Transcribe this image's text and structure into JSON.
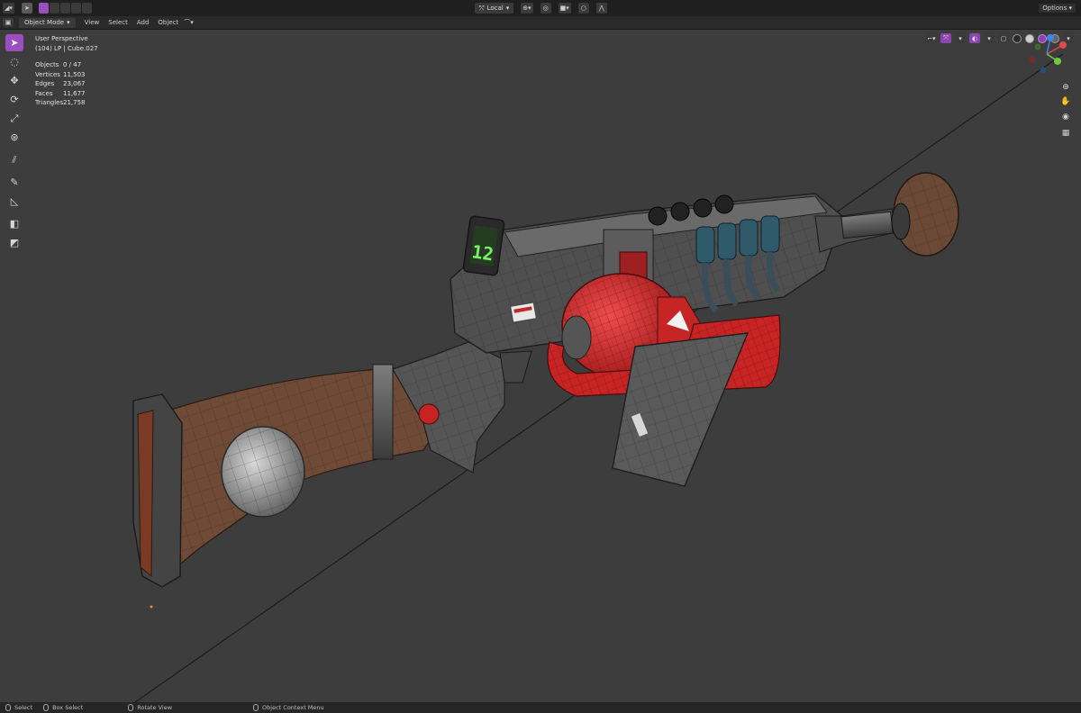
{
  "header": {
    "editor_icon": "3d-viewport-icon",
    "mode": "Object Mode",
    "menus": [
      "View",
      "Select",
      "Add",
      "Object"
    ],
    "transform_orientation": "Local",
    "options": "Options"
  },
  "overlay": {
    "view_name": "User Perspective",
    "object_name": "(104) LP | Cube.027",
    "stats": [
      {
        "label": "Objects",
        "value": "0 / 47"
      },
      {
        "label": "Vertices",
        "value": "11,503"
      },
      {
        "label": "Edges",
        "value": "23,067"
      },
      {
        "label": "Faces",
        "value": "11,677"
      },
      {
        "label": "Triangles",
        "value": "21,758"
      }
    ]
  },
  "toolbar": {
    "tools": [
      "select-box-icon",
      "cursor-icon",
      "move-icon",
      "rotate-icon",
      "scale-icon",
      "transform-icon",
      "annotate-icon",
      "draw-icon",
      "measure-icon",
      "add-cube-icon",
      "extrude-icon"
    ]
  },
  "gizmo": {
    "axes": [
      "X",
      "Y",
      "Z"
    ],
    "colors": {
      "x": "#e04a4a",
      "y": "#6fc940",
      "z": "#3f86e8"
    }
  },
  "statusbar": {
    "items": [
      "Select",
      "Box Select",
      "Rotate View",
      "Object Context Menu"
    ]
  },
  "counter_display": "12",
  "colors": {
    "viewport_bg": "#3d3d3d",
    "accent": "#9b4fbf",
    "drum_red": "#d62a2a",
    "wood": "#6e4a37"
  }
}
